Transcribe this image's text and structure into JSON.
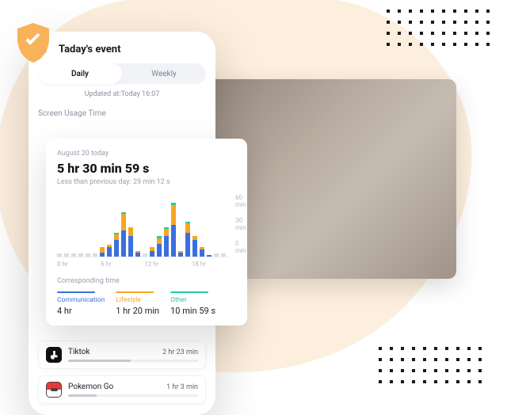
{
  "header": {
    "title": "Taday's event",
    "tabs": {
      "daily": "Daily",
      "weekly": "Weekly"
    },
    "updated": "Updated at:Today 16:07",
    "section_label": "Screen Usage Time"
  },
  "usage": {
    "date": "August 20 today",
    "total": "5 hr 30 min 59 s",
    "delta": "Less than previous day: 29 min 12 s",
    "corresponding_label": "Corresponding time"
  },
  "categories": {
    "communication": {
      "label": "Communication",
      "value": "4 hr"
    },
    "lifestyle": {
      "label": "Lifestyle",
      "value": "1 hr 20 min"
    },
    "other": {
      "label": "Other",
      "value": "10 min 59 s"
    }
  },
  "apps": {
    "tiktok": {
      "name": "Tiktok",
      "time": "2 hr 23 min"
    },
    "pokemon": {
      "name": "Pokemon Go",
      "time": "1 hr 3 min"
    }
  },
  "chart_data": {
    "type": "bar",
    "xlabel": "",
    "ylabel": "",
    "x_ticks": [
      "0 hr",
      "6 hr",
      "12 hr",
      "18 hr"
    ],
    "y_ticks": [
      "60 min",
      "30 min",
      "0 min"
    ],
    "ylim": [
      0,
      60
    ],
    "hours": [
      0,
      1,
      2,
      3,
      4,
      5,
      6,
      7,
      8,
      9,
      10,
      11,
      12,
      13,
      14,
      15,
      16,
      17,
      18,
      19,
      20,
      21,
      22,
      23
    ],
    "series": [
      {
        "name": "Communication",
        "color": "#3b6fe0",
        "values": [
          0,
          0,
          0,
          0,
          0,
          0,
          4,
          10,
          18,
          28,
          22,
          4,
          0,
          6,
          14,
          22,
          34,
          4,
          26,
          18,
          8,
          2,
          0,
          0
        ]
      },
      {
        "name": "Lifestyle",
        "color": "#f5a623",
        "values": [
          0,
          0,
          0,
          0,
          0,
          0,
          6,
          3,
          6,
          18,
          10,
          2,
          0,
          4,
          6,
          8,
          22,
          2,
          10,
          4,
          2,
          0,
          0,
          0
        ]
      },
      {
        "name": "Other",
        "color": "#28c8a0",
        "values": [
          0,
          0,
          0,
          0,
          0,
          0,
          0,
          0,
          2,
          2,
          0,
          0,
          0,
          0,
          2,
          2,
          2,
          0,
          2,
          0,
          0,
          0,
          0,
          0
        ]
      }
    ]
  }
}
